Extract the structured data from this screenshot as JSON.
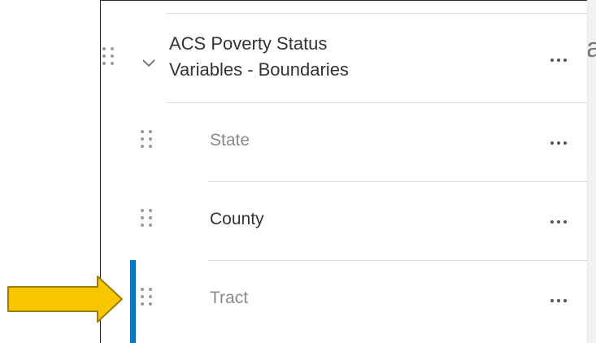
{
  "layer_list": {
    "group": {
      "title_line1": "ACS Poverty Status",
      "title_line2": "Variables - Boundaries",
      "expanded": true
    },
    "layers": [
      {
        "label": "State",
        "visible": false
      },
      {
        "label": "County",
        "visible": true
      },
      {
        "label": "Tract",
        "visible": false,
        "selected": true
      }
    ]
  },
  "colors": {
    "accent_bar": "#0079c1",
    "pointer_arrow_fill": "#f7c600",
    "pointer_arrow_stroke": "#9a7d00"
  },
  "icons": {
    "drag_handle": "drag-handle-icon",
    "options": "more-options-icon",
    "expand": "chevron-down-icon",
    "pointer": "arrow-right-icon"
  }
}
